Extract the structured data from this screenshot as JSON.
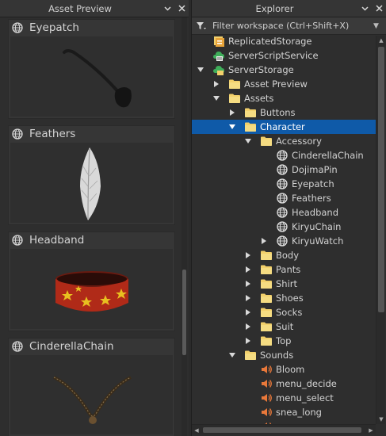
{
  "asset_preview": {
    "title": "Asset Preview",
    "cards": [
      {
        "name": "Eyepatch"
      },
      {
        "name": "Feathers"
      },
      {
        "name": "Headband"
      },
      {
        "name": "CinderellaChain"
      }
    ]
  },
  "explorer": {
    "title": "Explorer",
    "filter_placeholder": "Filter workspace (Ctrl+Shift+X)",
    "selection_color": "#0f5aa8",
    "items": [
      {
        "label": "ReplicatedStorage",
        "icon": "replicated-storage-icon"
      },
      {
        "label": "ServerScriptService",
        "icon": "server-script-service-icon"
      },
      {
        "label": "ServerStorage",
        "icon": "server-storage-icon"
      },
      {
        "label": "Asset Preview",
        "icon": "folder-icon"
      },
      {
        "label": "Assets",
        "icon": "folder-icon"
      },
      {
        "label": "Buttons",
        "icon": "folder-icon"
      },
      {
        "label": "Character",
        "icon": "folder-icon"
      },
      {
        "label": "Accessory",
        "icon": "folder-icon"
      },
      {
        "label": "CinderellaChain",
        "icon": "accessory-icon"
      },
      {
        "label": "DojimaPin",
        "icon": "accessory-icon"
      },
      {
        "label": "Eyepatch",
        "icon": "accessory-icon"
      },
      {
        "label": "Feathers",
        "icon": "accessory-icon"
      },
      {
        "label": "Headband",
        "icon": "accessory-icon"
      },
      {
        "label": "KiryuChain",
        "icon": "accessory-icon"
      },
      {
        "label": "KiryuWatch",
        "icon": "accessory-icon"
      },
      {
        "label": "Body",
        "icon": "folder-icon"
      },
      {
        "label": "Pants",
        "icon": "folder-icon"
      },
      {
        "label": "Shirt",
        "icon": "folder-icon"
      },
      {
        "label": "Shoes",
        "icon": "folder-icon"
      },
      {
        "label": "Socks",
        "icon": "folder-icon"
      },
      {
        "label": "Suit",
        "icon": "folder-icon"
      },
      {
        "label": "Top",
        "icon": "folder-icon"
      },
      {
        "label": "Sounds",
        "icon": "folder-icon"
      },
      {
        "label": "Bloom",
        "icon": "sound-icon"
      },
      {
        "label": "menu_decide",
        "icon": "sound-icon"
      },
      {
        "label": "menu_select",
        "icon": "sound-icon"
      },
      {
        "label": "snea_long",
        "icon": "sound-icon"
      },
      {
        "label": "",
        "icon": "sound-icon"
      }
    ]
  }
}
